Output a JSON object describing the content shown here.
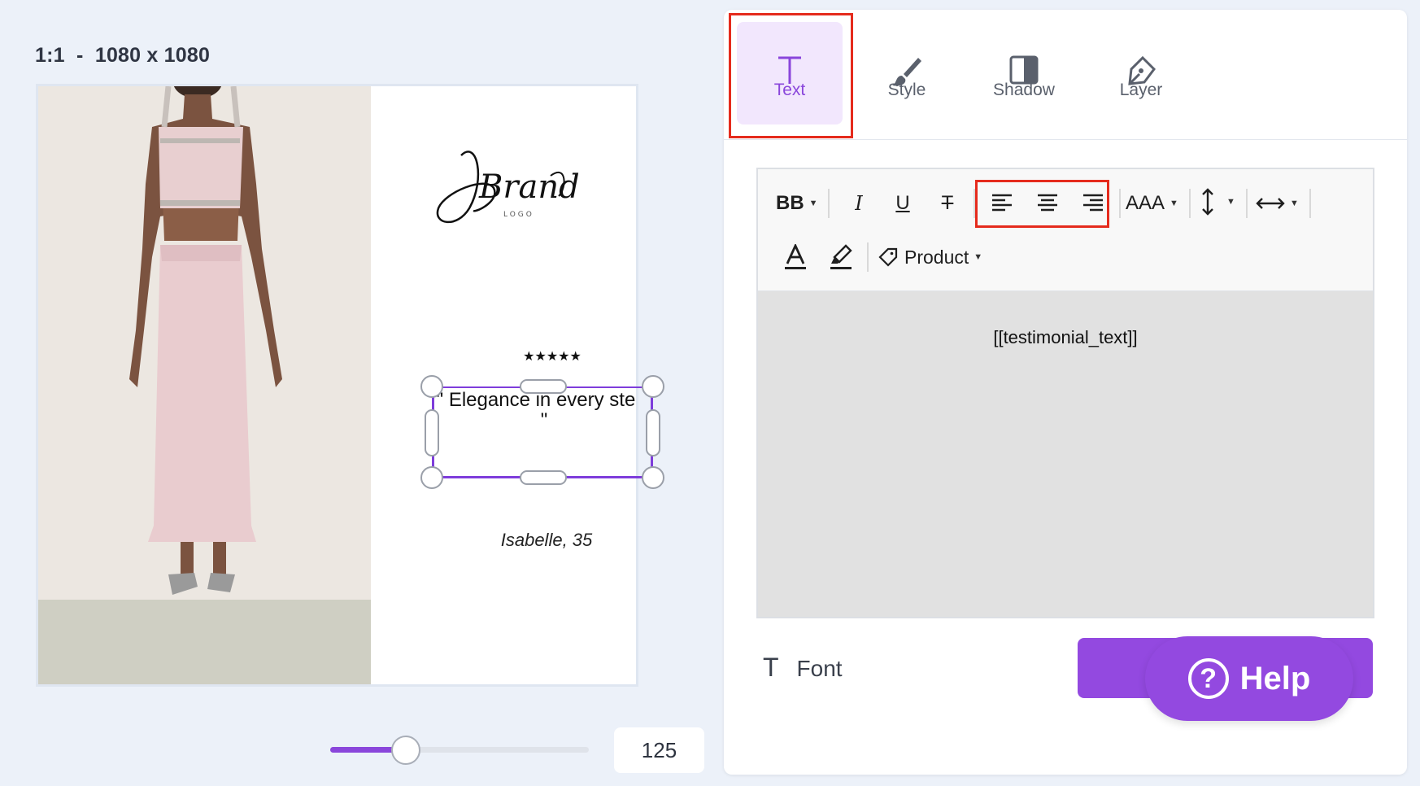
{
  "canvas": {
    "size_label": "1:1  -  1080 x 1080",
    "stars": "★★★★★",
    "quote": "\" Elegance in every step. \"",
    "author": "Isabelle, 35",
    "logo_text": "Brand",
    "logo_sub": "LOGO"
  },
  "zoom": {
    "value": "125",
    "level_fraction": 0.3
  },
  "tabs": [
    {
      "label": "Text",
      "icon": "text-icon",
      "active": true
    },
    {
      "label": "Style",
      "icon": "brush-icon"
    },
    {
      "label": "Shadow",
      "icon": "shadow-icon"
    },
    {
      "label": "Layer",
      "icon": "pen-icon"
    }
  ],
  "toolbar": {
    "bold_label": "BB",
    "font_size_label": "AAA",
    "product_label": "Product"
  },
  "editor": {
    "content": "[[testimonial_text]]"
  },
  "font_section": {
    "icon": "T",
    "label": "Font"
  },
  "help": {
    "label": "Help",
    "icon": "?"
  },
  "colors": {
    "accent": "#8a46db",
    "highlight": "#e52b1d",
    "tab_active_bg": "#f2e7fd"
  }
}
